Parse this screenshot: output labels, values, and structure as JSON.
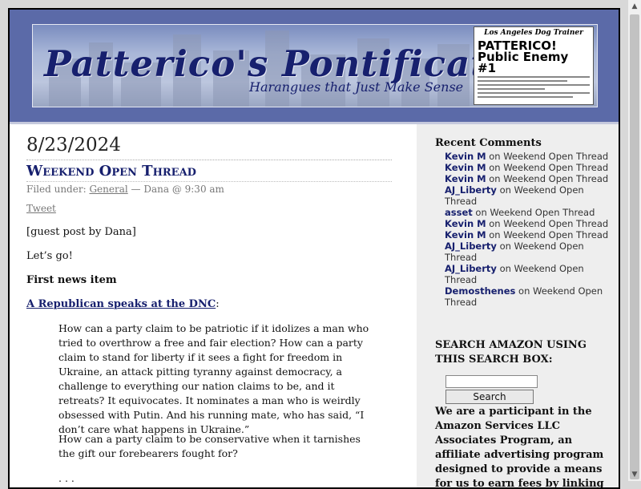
{
  "header": {
    "site_title": "Patterico's Pontifications",
    "tagline": "Harangues that Just Make Sense",
    "clipping": {
      "masthead": "Los Angeles Dog Trainer",
      "headline": "PATTERICO! Public Enemy #1"
    }
  },
  "post": {
    "date": "8/23/2024",
    "title": "Weekend Open Thread",
    "meta_prefix": "Filed under:",
    "category": "General",
    "meta_suffix": "— Dana @ 9:30 am",
    "tweet": "Tweet",
    "paragraphs": [
      "[guest post by Dana]",
      "Let’s go!",
      "First news item"
    ],
    "link_text": "A Republican speaks at the DNC",
    "link_suffix": ":",
    "quote1": "How can a party claim to be patriotic if it idolizes a man who tried to overthrow a free and fair election? How can a party claim to stand for liberty if it sees a fight for freedom in Ukraine, an attack pitting tyranny against democracy, a challenge to everything our nation claims to be, and it retreats? It equivocates. It nominates a man who is weirdly obsessed with Putin. And his running mate, who has said, “I don’t care what happens in Ukraine.”",
    "quote2": "How can a party claim to be conservative when it tarnishes the gift our forebearers fought for?",
    "ellipsis": ". . ."
  },
  "sidebar": {
    "recent_comments_heading": "Recent Comments",
    "on_text": "on",
    "recent_comments": [
      {
        "author": "Kevin M",
        "post": "Weekend Open Thread"
      },
      {
        "author": "Kevin M",
        "post": "Weekend Open Thread"
      },
      {
        "author": "Kevin M",
        "post": "Weekend Open Thread"
      },
      {
        "author": "AJ_Liberty",
        "post": "Weekend Open Thread"
      },
      {
        "author": "asset",
        "post": "Weekend Open Thread"
      },
      {
        "author": "Kevin M",
        "post": "Weekend Open Thread"
      },
      {
        "author": "Kevin M",
        "post": "Weekend Open Thread"
      },
      {
        "author": "AJ_Liberty",
        "post": "Weekend Open Thread"
      },
      {
        "author": "AJ_Liberty",
        "post": "Weekend Open Thread"
      },
      {
        "author": "Demosthenes",
        "post": "Weekend Open Thread"
      }
    ],
    "amazon_heading": "SEARCH AMAZON USING THIS SEARCH BOX:",
    "amazon_input_value": "",
    "amazon_button": "Search",
    "disclosure": "We are a participant in the Amazon Services LLC Associates Program, an affiliate advertising program designed to provide a means for us to earn fees by linking to Amazon.com and"
  },
  "colors": {
    "header_bg": "#5b6aa8",
    "title_navy": "#17206e",
    "sidebar_bg": "#eeeeee"
  },
  "icons": {
    "scroll_up": "▲",
    "scroll_down": "▼"
  }
}
